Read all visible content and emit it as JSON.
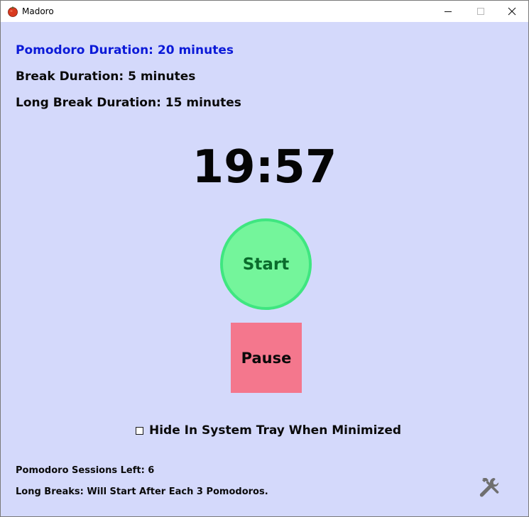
{
  "window": {
    "title": "Madoro",
    "icon": "tomato-icon",
    "controls": [
      "minimize-icon",
      "maximize-icon",
      "close-icon"
    ]
  },
  "durations": {
    "pomodoro": "Pomodoro Duration: 20 minutes",
    "break": "Break Duration: 5 minutes",
    "long_break": "Long Break Duration: 15 minutes"
  },
  "timer": {
    "display": "19:57"
  },
  "controls": {
    "start_label": "Start",
    "pause_label": "Pause"
  },
  "options": {
    "tray_label": "Hide In System Tray When Minimized",
    "tray_checked": false
  },
  "status": {
    "sessions_left": "Pomodoro Sessions Left: 6",
    "long_breaks": "Long Breaks: Will Start After Each 3 Pomodoros."
  },
  "settings": {
    "icon": "tools-icon"
  },
  "colors": {
    "background": "#d4d9fb",
    "pomodoro_text": "#0b1ad8",
    "start_fill": "#74f59b",
    "start_border": "#3fe680",
    "start_text": "#0a6b2c",
    "pause_fill": "#f4778d"
  }
}
